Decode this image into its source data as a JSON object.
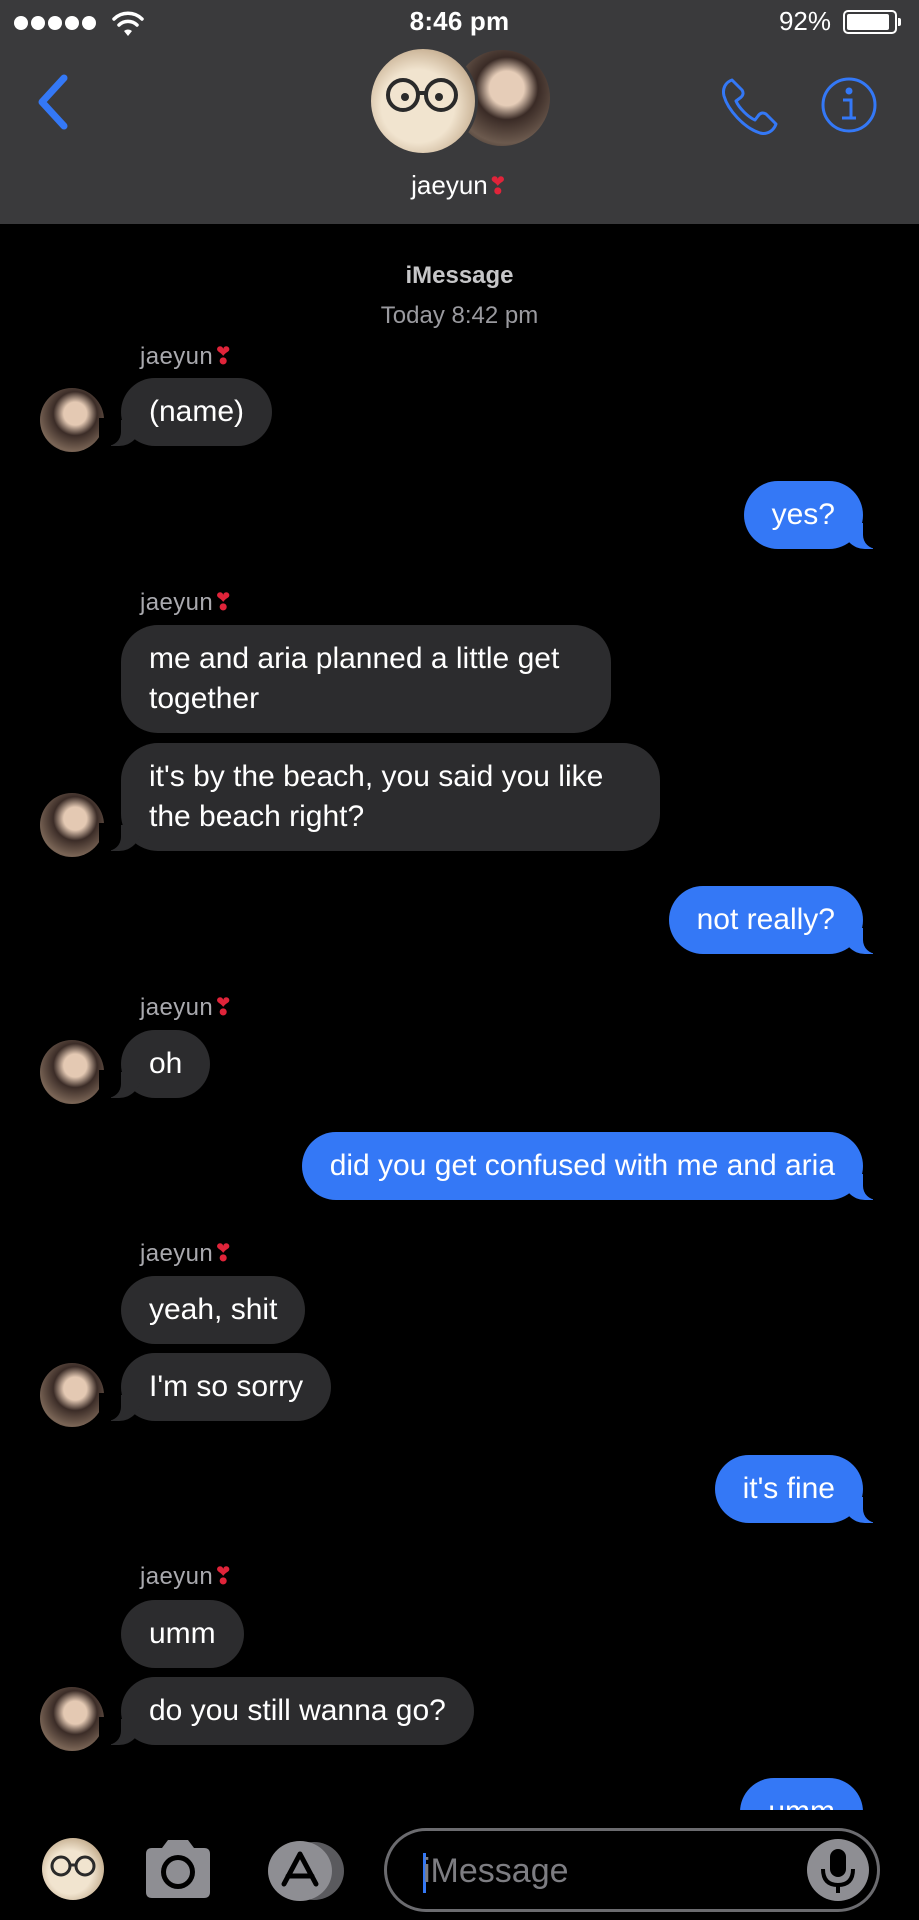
{
  "status_bar": {
    "time": "8:46 pm",
    "battery": "92%",
    "signal_dots": 5
  },
  "header": {
    "contact_name": "jaeyun",
    "heart": "❣"
  },
  "chat": {
    "service": "iMessage",
    "timestamp": "Today 8:42 pm"
  },
  "messages": [
    {
      "sender": "jaeyun",
      "text": "(name)"
    },
    {
      "from": "me",
      "text": "yes?"
    },
    {
      "sender": "jaeyun",
      "text": "me and aria planned a little get together"
    },
    {
      "text": "it's by the beach, you said you like the beach right?"
    },
    {
      "from": "me",
      "text": "not really?"
    },
    {
      "sender": "jaeyun",
      "text": "oh"
    },
    {
      "from": "me",
      "text": "did you get confused with me and aria"
    },
    {
      "sender": "jaeyun",
      "text": "yeah, shit"
    },
    {
      "text": "I'm so sorry"
    },
    {
      "from": "me",
      "text": "it's fine"
    },
    {
      "sender": "jaeyun",
      "text": "umm"
    },
    {
      "text": "do you still wanna go?"
    },
    {
      "from": "me",
      "text": "umm"
    }
  ],
  "input": {
    "placeholder": "iMessage"
  },
  "colors": {
    "accent": "#3478f6",
    "incoming_bubble": "#2c2c2e",
    "header_bg": "#3a3a3c",
    "heart": "#e0243a"
  },
  "icons": [
    "back-chevron-icon",
    "phone-icon",
    "info-icon",
    "camera-icon",
    "app-store-icon",
    "microphone-icon"
  ]
}
